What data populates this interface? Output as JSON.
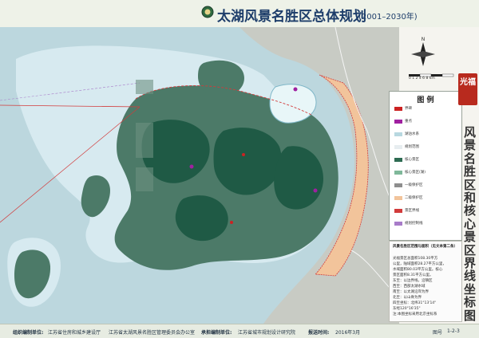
{
  "header": {
    "title": "太湖风景名胜区总体规划",
    "years": "(2001–2030年)"
  },
  "sidebar": {
    "seal_text": "光福",
    "vertical_title": "风景名胜区和核心景区界线坐标图",
    "north_label": "N",
    "scale_label": "0 1 2 4 6 8 km"
  },
  "legend": {
    "title": "图 例",
    "items": [
      {
        "label": "界碑",
        "color": "#cc2222"
      },
      {
        "label": "重点",
        "color": "#a020a0"
      },
      {
        "label": "湖泊水系",
        "color": "#b8d8e0"
      },
      {
        "label": "规划范围",
        "color": "#e7edf0"
      },
      {
        "label": "核心景区",
        "color": "#2e6b52"
      },
      {
        "label": "核心景区(湖)",
        "color": "#7fb89a"
      },
      {
        "label": "一级保护区",
        "color": "#8e8e8e"
      },
      {
        "label": "二级保护区",
        "color": "#f2c49b"
      },
      {
        "label": "景区界线",
        "color": "#d23b3b"
      },
      {
        "label": "规划控制线",
        "color": "#a87cc9"
      }
    ]
  },
  "note": {
    "title": "风景名胜区范围与面积（见文本第二条）",
    "lines": [
      "光福景区总面积108.30平方",
      "公里，陆域面积28.27平方公里，",
      "水域面积80.03平方公里。核心",
      "景区面积8.31平方公里。",
      "东至：以边界线，沿镇区",
      "西至：西部太湖水域",
      "南至：以太湖沿岸为界",
      "北至：以山脊为界",
      "四至坐标：北纬31°13'14\"",
      "东经120°16'35\"",
      "注:本图坐标采用北京坐标系"
    ]
  },
  "footer": {
    "org_label": "组织编制单位:",
    "org1": "江苏省住房和城乡建设厅",
    "org2": "江苏省太湖风景名胜区管理委员会办公室",
    "undertake_label": "承担编制单位:",
    "undertake": "江苏省城市规划设计研究院",
    "date_label": "报送时间:",
    "date": "2016年3月",
    "page_label": "图号",
    "page": "1-2-3"
  }
}
